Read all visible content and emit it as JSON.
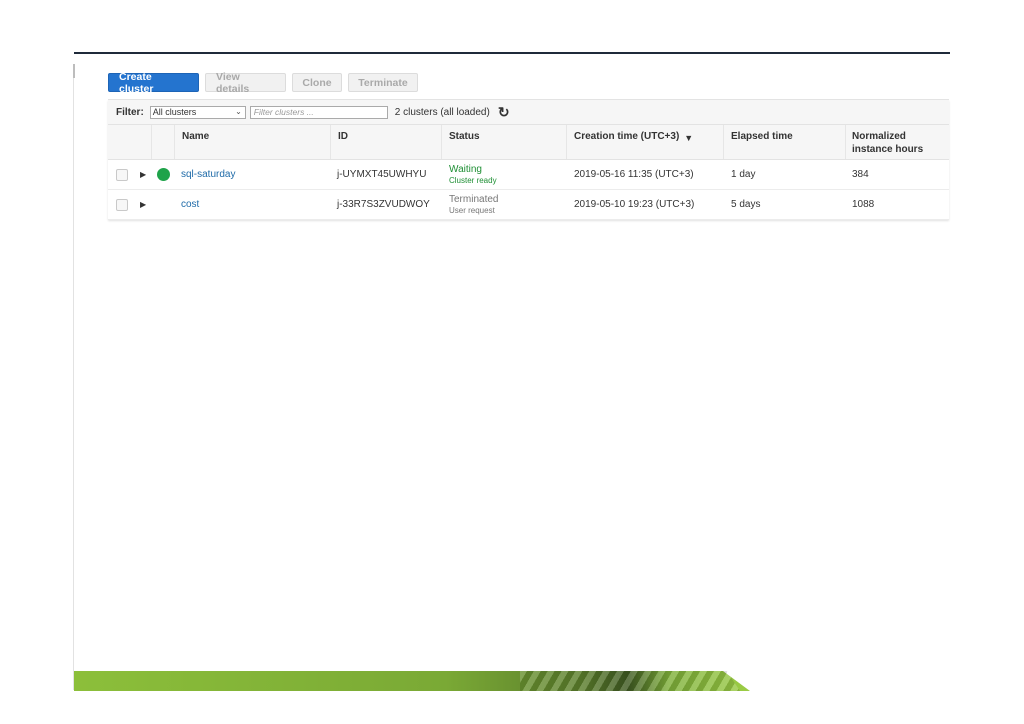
{
  "toolbar": {
    "create_cluster": "Create cluster",
    "view_details": "View details",
    "clone": "Clone",
    "terminate": "Terminate"
  },
  "filter": {
    "label": "Filter:",
    "selected": "All clusters",
    "search_placeholder": "Filter clusters ...",
    "loaded_text": "2 clusters (all loaded)",
    "refresh_icon": "↻"
  },
  "columns": {
    "name": "Name",
    "id": "ID",
    "status": "Status",
    "creation_time": "Creation time (UTC+3)",
    "elapsed_time": "Elapsed time",
    "normalized_hours": "Normalized\ninstance hours"
  },
  "rows": [
    {
      "name": "sql-saturday",
      "id": "j-UYMXT45UWHYU",
      "status": "Waiting",
      "status_detail": "Cluster ready",
      "creation_time": "2019-05-16 11:35 (UTC+3)",
      "elapsed": "1 day",
      "hours": "384"
    },
    {
      "name": "cost",
      "id": "j-33R7S3ZVUDWOY",
      "status": "Terminated",
      "status_detail": "User request",
      "creation_time": "2019-05-10 19:23 (UTC+3)",
      "elapsed": "5 days",
      "hours": "1088"
    }
  ],
  "colors": {
    "primary_button": "#2474cf",
    "status_waiting": "#1e8f34",
    "link": "#1e6aa8"
  }
}
